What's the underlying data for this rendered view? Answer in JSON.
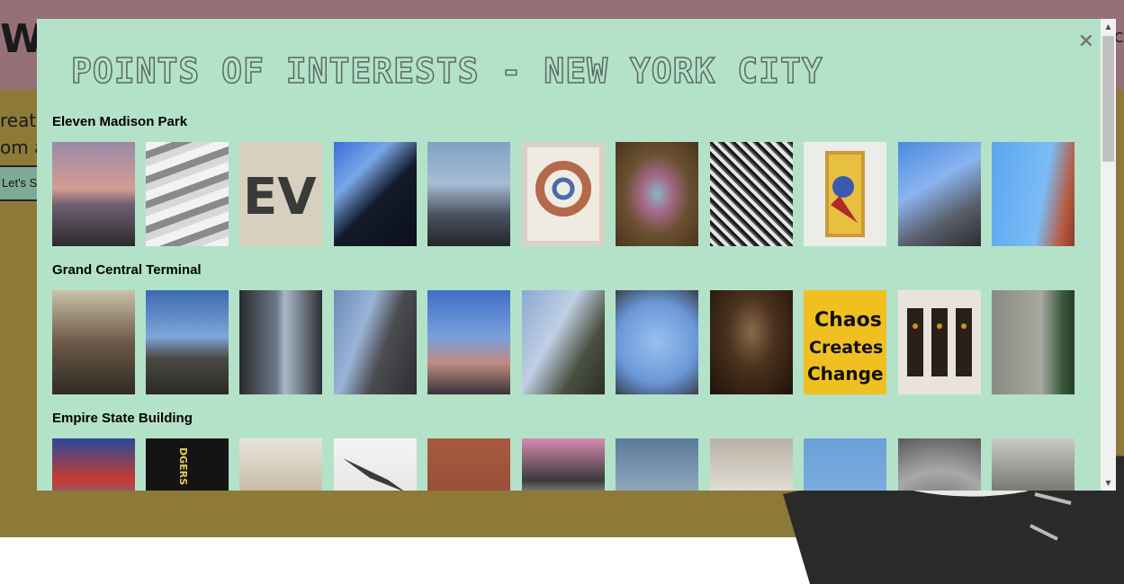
{
  "background": {
    "logo": "W",
    "nav_item": "C",
    "line1": "reate",
    "line2": "om a",
    "cta_label": "Let's S"
  },
  "modal": {
    "close_label": "×",
    "title": "POINTS OF INTERESTS - NEW YORK CITY",
    "sections": [
      {
        "name": "Eleven Madison Park"
      },
      {
        "name": "Grand Central Terminal"
      },
      {
        "name": "Empire State Building"
      }
    ]
  },
  "scrollbar": {
    "up": "▲",
    "down": "▼"
  }
}
